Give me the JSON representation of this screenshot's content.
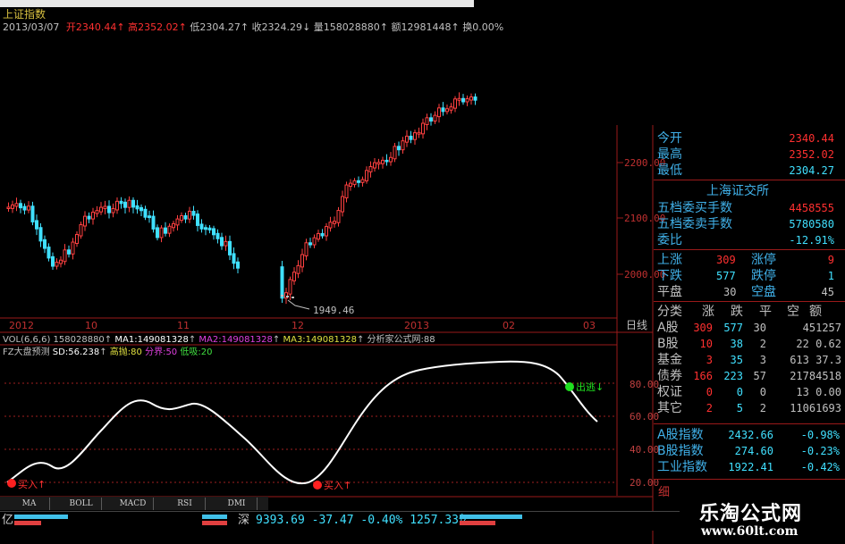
{
  "header": {
    "title": "上证指数",
    "date": "2013/03/07",
    "open_label": "开",
    "open": "2340.44",
    "high_label": "高",
    "high": "2352.02",
    "low_label": "低",
    "low": "2304.27",
    "close_label": "收",
    "close": "2324.29",
    "vol_label": "量",
    "vol": "158028880",
    "amount_label": "额",
    "amount": "12981448",
    "turnover_label": "换",
    "turnover": "0.00%"
  },
  "price_axis": {
    "ticks": [
      "2200.00",
      "2100.00",
      "2000.00"
    ],
    "low_marker": "1949.46"
  },
  "time_axis": {
    "labels": [
      "2012",
      "10",
      "11",
      "12",
      "2013",
      "02",
      "03"
    ],
    "right_label": "日线"
  },
  "volume_line": {
    "text": "VOL(6,6,6) 158028880",
    "ma1": "MA1:149081328",
    "ma2": "MA2:149081328",
    "ma3": "MA3:149081328",
    "note": "分析家公式网:88"
  },
  "indicator": {
    "name": "FZ大盘预测",
    "sd": "SD:56.238",
    "high_risk": "高抛:80",
    "boundary": "分界:50",
    "low_buy": "低吸:20",
    "grid_labels": [
      "80.00",
      "60.00",
      "40.00",
      "20.00"
    ],
    "signal_buy_1": "买入",
    "signal_buy_2": "买入",
    "signal_sell": "出逃",
    "colors": {
      "line": "#ffffff",
      "buy": "#ff2020",
      "sell": "#20e020"
    }
  },
  "tabs": [
    "MA",
    "BOLL",
    "MACD",
    "RSI",
    "DMI"
  ],
  "bottom_bar": {
    "left_unit": "亿",
    "market": "深",
    "index": "9393.69",
    "change": "-37.47",
    "pct": "-0.40%",
    "amount": "1257.33亿"
  },
  "quote_panel": {
    "rows": [
      {
        "label": "今开",
        "value": "2340.44"
      },
      {
        "label": "最高",
        "value": "2352.02"
      },
      {
        "label": "最低",
        "value": "2304.27"
      }
    ],
    "exchange_title": "上海证交所",
    "buy_label": "五档委买手数",
    "buy_value": "4458555",
    "sell_label": "五档委卖手数",
    "sell_value": "5780580",
    "ratio_label": "委比",
    "ratio_value": "-12.91%",
    "up_label": "上涨",
    "up_value": "309",
    "limit_up_label": "涨停",
    "limit_up_value": "9",
    "down_label": "下跌",
    "down_value": "577",
    "limit_down_label": "跌停",
    "limit_down_value": "1",
    "flat_label": "平盘",
    "flat_value": "30",
    "empty_label": "空盘",
    "empty_value": "45"
  },
  "classification": {
    "headers": [
      "分类",
      "涨",
      "跌",
      "平",
      "空",
      "额"
    ],
    "rows": [
      {
        "name": "A股",
        "up": "309",
        "down": "577",
        "flat": "30",
        "amount": "451257"
      },
      {
        "name": "B股",
        "up": "10",
        "down": "38",
        "flat": "2",
        "amount": "22 0.62"
      },
      {
        "name": "基金",
        "up": "3",
        "down": "35",
        "flat": "3",
        "amount": "613 37.3"
      },
      {
        "name": "债券",
        "up": "166",
        "down": "223",
        "flat": "57",
        "amount": "21784518"
      },
      {
        "name": "权证",
        "up": "0",
        "down": "0",
        "flat": "0",
        "amount": "13 0.00"
      },
      {
        "name": "其它",
        "up": "2",
        "down": "5",
        "flat": "2",
        "amount": "11061693"
      }
    ]
  },
  "indices": [
    {
      "name": "A股指数",
      "value": "2432.66",
      "pct": "-0.98%"
    },
    {
      "name": "B股指数",
      "value": "274.60",
      "pct": "-0.23%"
    },
    {
      "name": "工业指数",
      "value": "1922.41",
      "pct": "-0.42%"
    }
  ],
  "watermark": {
    "title": "乐淘公式网",
    "url": "www.60lt.com"
  },
  "colors": {
    "up": "#ff3030",
    "down": "#40e0ff",
    "label_blue": "#40b0e8",
    "axis_red": "#b02020"
  }
}
